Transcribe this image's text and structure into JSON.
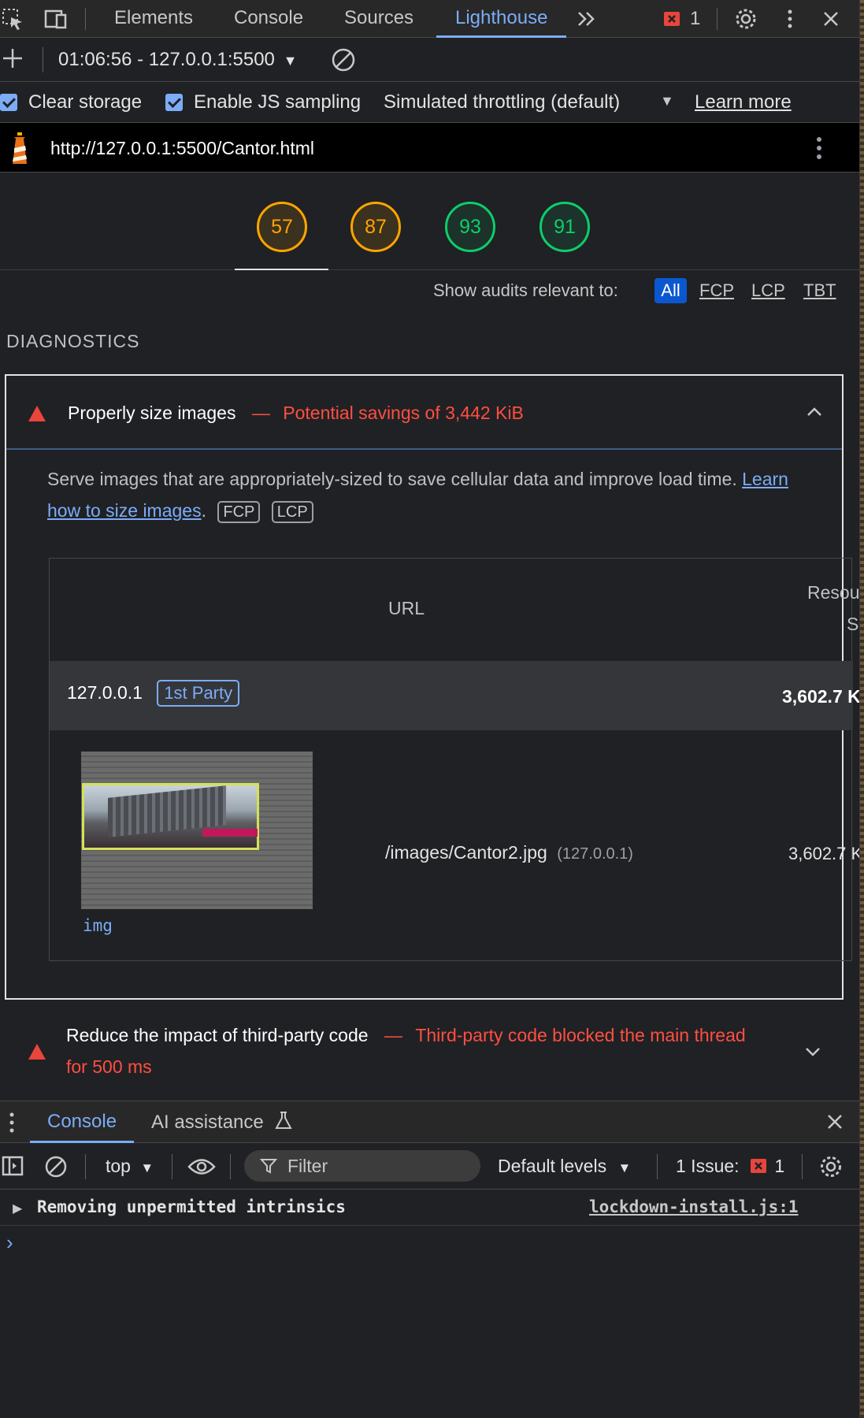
{
  "devtools": {
    "tabs": [
      "Elements",
      "Console",
      "Sources",
      "Lighthouse"
    ],
    "active_tab": "Lighthouse",
    "issue_count": "1"
  },
  "toolbar": {
    "report_selector": "01:06:56 - 127.0.0.1:5500",
    "clear_storage": "Clear storage",
    "enable_js_sampling": "Enable JS sampling",
    "throttling": "Simulated throttling (default)",
    "learn_more": "Learn more"
  },
  "report": {
    "url": "http://127.0.0.1:5500/Cantor.html",
    "scores": [
      {
        "value": "57",
        "color": "#ffa400"
      },
      {
        "value": "87",
        "color": "#ffa400"
      },
      {
        "value": "93",
        "color": "#0cce6b"
      },
      {
        "value": "91",
        "color": "#0cce6b"
      }
    ]
  },
  "filter": {
    "label": "Show audits relevant to:",
    "chips": [
      "All",
      "FCP",
      "LCP",
      "TBT"
    ],
    "active": "All"
  },
  "diagnostics": {
    "heading": "DIAGNOSTICS",
    "audit1": {
      "title": "Properly size images",
      "separator": "—",
      "savings": "Potential savings of 3,442 KiB",
      "description": "Serve images that are appropriately-sized to save cellular data and improve load time.",
      "link_part1": "Learn",
      "link_part2": "how to size images",
      "tags": [
        "FCP",
        "LCP"
      ],
      "table": {
        "col_url": "URL",
        "col_resource_1": "Resour",
        "col_resource_2": "Si",
        "party": {
          "host": "127.0.0.1",
          "badge": "1st Party",
          "size": "3,602.7 K"
        },
        "item": {
          "path": "/images/Cantor2.jpg",
          "host": "(127.0.0.1)",
          "size": "3,602.7 K",
          "node": "img"
        }
      }
    },
    "audit2": {
      "title": "Reduce the impact of third-party code",
      "separator": "—",
      "detail_line1": "Third-party code blocked the main thread",
      "detail_line2": "for 500 ms"
    }
  },
  "drawer": {
    "tabs": [
      "Console",
      "AI assistance"
    ],
    "active_tab": "Console",
    "context": "top",
    "filter_placeholder": "Filter",
    "levels": "Default levels",
    "issues_label": "1 Issue:",
    "issues_count": "1",
    "messages": [
      {
        "text": "Removing unpermitted intrinsics",
        "source": "lockdown-install.js:1"
      }
    ],
    "prompt": "›"
  }
}
